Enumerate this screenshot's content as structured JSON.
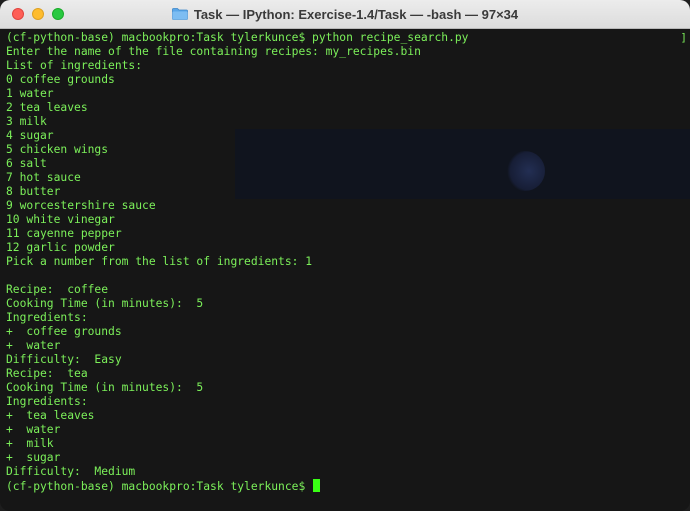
{
  "window": {
    "title": "Task — IPython: Exercise-1.4/Task — -bash — 97×34"
  },
  "terminal": {
    "lines": [
      "(cf-python-base) macbookpro:Task tylerkunce$ python recipe_search.py",
      "Enter the name of the file containing recipes: my_recipes.bin",
      "List of ingredients:",
      "0 coffee grounds",
      "1 water",
      "2 tea leaves",
      "3 milk",
      "4 sugar",
      "5 chicken wings",
      "6 salt",
      "7 hot sauce",
      "8 butter",
      "9 worcestershire sauce",
      "10 white vinegar",
      "11 cayenne pepper",
      "12 garlic powder",
      "Pick a number from the list of ingredients: 1",
      "",
      "Recipe:  coffee",
      "Cooking Time (in minutes):  5",
      "Ingredients:",
      "+  coffee grounds",
      "+  water",
      "Difficulty:  Easy",
      "Recipe:  tea",
      "Cooking Time (in minutes):  5",
      "Ingredients:",
      "+  tea leaves",
      "+  water",
      "+  milk",
      "+  sugar",
      "Difficulty:  Medium"
    ],
    "prompt": "(cf-python-base) macbookpro:Task tylerkunce$ "
  },
  "colors": {
    "text": "#7cf05a",
    "cursor": "#39ff14",
    "background": "#161616"
  }
}
